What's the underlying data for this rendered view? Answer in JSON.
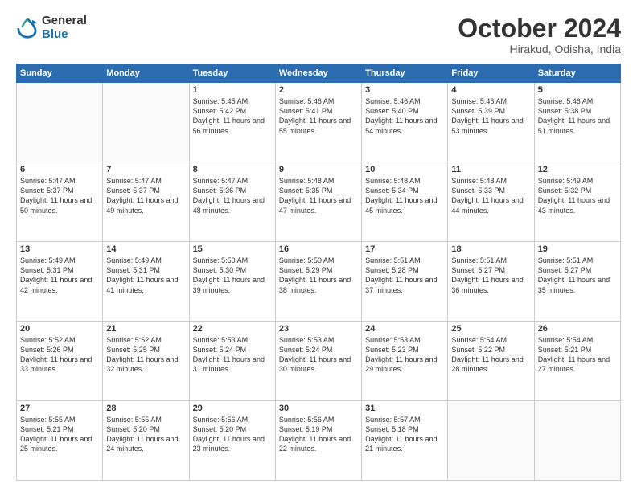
{
  "logo": {
    "general": "General",
    "blue": "Blue"
  },
  "title": "October 2024",
  "subtitle": "Hirakud, Odisha, India",
  "headers": [
    "Sunday",
    "Monday",
    "Tuesday",
    "Wednesday",
    "Thursday",
    "Friday",
    "Saturday"
  ],
  "weeks": [
    [
      {
        "day": "",
        "content": ""
      },
      {
        "day": "",
        "content": ""
      },
      {
        "day": "1",
        "content": "Sunrise: 5:45 AM\nSunset: 5:42 PM\nDaylight: 11 hours and 56 minutes."
      },
      {
        "day": "2",
        "content": "Sunrise: 5:46 AM\nSunset: 5:41 PM\nDaylight: 11 hours and 55 minutes."
      },
      {
        "day": "3",
        "content": "Sunrise: 5:46 AM\nSunset: 5:40 PM\nDaylight: 11 hours and 54 minutes."
      },
      {
        "day": "4",
        "content": "Sunrise: 5:46 AM\nSunset: 5:39 PM\nDaylight: 11 hours and 53 minutes."
      },
      {
        "day": "5",
        "content": "Sunrise: 5:46 AM\nSunset: 5:38 PM\nDaylight: 11 hours and 51 minutes."
      }
    ],
    [
      {
        "day": "6",
        "content": "Sunrise: 5:47 AM\nSunset: 5:37 PM\nDaylight: 11 hours and 50 minutes."
      },
      {
        "day": "7",
        "content": "Sunrise: 5:47 AM\nSunset: 5:37 PM\nDaylight: 11 hours and 49 minutes."
      },
      {
        "day": "8",
        "content": "Sunrise: 5:47 AM\nSunset: 5:36 PM\nDaylight: 11 hours and 48 minutes."
      },
      {
        "day": "9",
        "content": "Sunrise: 5:48 AM\nSunset: 5:35 PM\nDaylight: 11 hours and 47 minutes."
      },
      {
        "day": "10",
        "content": "Sunrise: 5:48 AM\nSunset: 5:34 PM\nDaylight: 11 hours and 45 minutes."
      },
      {
        "day": "11",
        "content": "Sunrise: 5:48 AM\nSunset: 5:33 PM\nDaylight: 11 hours and 44 minutes."
      },
      {
        "day": "12",
        "content": "Sunrise: 5:49 AM\nSunset: 5:32 PM\nDaylight: 11 hours and 43 minutes."
      }
    ],
    [
      {
        "day": "13",
        "content": "Sunrise: 5:49 AM\nSunset: 5:31 PM\nDaylight: 11 hours and 42 minutes."
      },
      {
        "day": "14",
        "content": "Sunrise: 5:49 AM\nSunset: 5:31 PM\nDaylight: 11 hours and 41 minutes."
      },
      {
        "day": "15",
        "content": "Sunrise: 5:50 AM\nSunset: 5:30 PM\nDaylight: 11 hours and 39 minutes."
      },
      {
        "day": "16",
        "content": "Sunrise: 5:50 AM\nSunset: 5:29 PM\nDaylight: 11 hours and 38 minutes."
      },
      {
        "day": "17",
        "content": "Sunrise: 5:51 AM\nSunset: 5:28 PM\nDaylight: 11 hours and 37 minutes."
      },
      {
        "day": "18",
        "content": "Sunrise: 5:51 AM\nSunset: 5:27 PM\nDaylight: 11 hours and 36 minutes."
      },
      {
        "day": "19",
        "content": "Sunrise: 5:51 AM\nSunset: 5:27 PM\nDaylight: 11 hours and 35 minutes."
      }
    ],
    [
      {
        "day": "20",
        "content": "Sunrise: 5:52 AM\nSunset: 5:26 PM\nDaylight: 11 hours and 33 minutes."
      },
      {
        "day": "21",
        "content": "Sunrise: 5:52 AM\nSunset: 5:25 PM\nDaylight: 11 hours and 32 minutes."
      },
      {
        "day": "22",
        "content": "Sunrise: 5:53 AM\nSunset: 5:24 PM\nDaylight: 11 hours and 31 minutes."
      },
      {
        "day": "23",
        "content": "Sunrise: 5:53 AM\nSunset: 5:24 PM\nDaylight: 11 hours and 30 minutes."
      },
      {
        "day": "24",
        "content": "Sunrise: 5:53 AM\nSunset: 5:23 PM\nDaylight: 11 hours and 29 minutes."
      },
      {
        "day": "25",
        "content": "Sunrise: 5:54 AM\nSunset: 5:22 PM\nDaylight: 11 hours and 28 minutes."
      },
      {
        "day": "26",
        "content": "Sunrise: 5:54 AM\nSunset: 5:21 PM\nDaylight: 11 hours and 27 minutes."
      }
    ],
    [
      {
        "day": "27",
        "content": "Sunrise: 5:55 AM\nSunset: 5:21 PM\nDaylight: 11 hours and 25 minutes."
      },
      {
        "day": "28",
        "content": "Sunrise: 5:55 AM\nSunset: 5:20 PM\nDaylight: 11 hours and 24 minutes."
      },
      {
        "day": "29",
        "content": "Sunrise: 5:56 AM\nSunset: 5:20 PM\nDaylight: 11 hours and 23 minutes."
      },
      {
        "day": "30",
        "content": "Sunrise: 5:56 AM\nSunset: 5:19 PM\nDaylight: 11 hours and 22 minutes."
      },
      {
        "day": "31",
        "content": "Sunrise: 5:57 AM\nSunset: 5:18 PM\nDaylight: 11 hours and 21 minutes."
      },
      {
        "day": "",
        "content": ""
      },
      {
        "day": "",
        "content": ""
      }
    ]
  ]
}
